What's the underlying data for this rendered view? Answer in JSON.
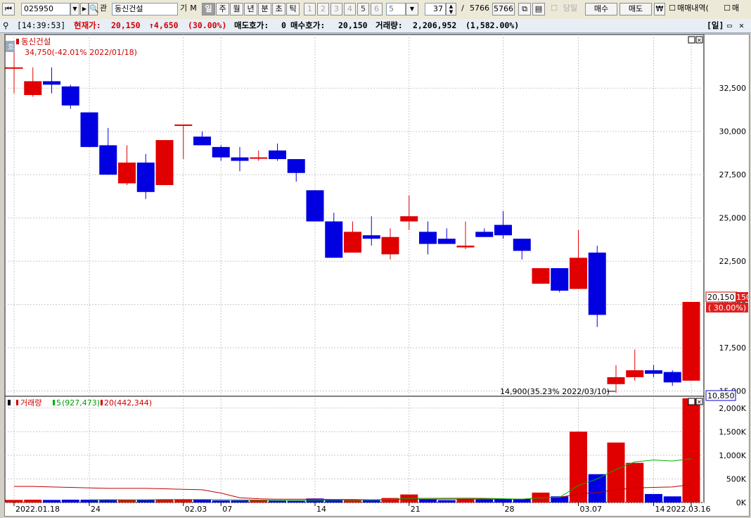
{
  "toolbar": {
    "stock_code": "025950",
    "group_label": "관",
    "stock_name": "동신건설",
    "ki_label": "기",
    "m_label": "M",
    "periods": [
      "일",
      "주",
      "월",
      "년",
      "분",
      "초",
      "틱"
    ],
    "active_period": "일",
    "number_buttons": [
      "1",
      "2",
      "3",
      "4",
      "5",
      "6"
    ],
    "interval_value": "5",
    "count_value": "37",
    "total_sep": "/",
    "total_1": "5766",
    "total_2": "5766",
    "today_label": "당일",
    "buy_label": "매수",
    "sell_label": "매도",
    "won_label": "₩",
    "trade_history_label": "매매내역(",
    "trade_history_label_2": "매"
  },
  "infobar": {
    "time": "[14:39:53]",
    "current_label": "현재가:",
    "current_price": "20,150",
    "change": "↑4,650",
    "change_pct": "(30.00%)",
    "ask_label": "매도호가:",
    "ask_value": "0",
    "bid_label": "매수호가:",
    "bid_value": "20,150",
    "volume_label": "거래량:",
    "volume_value": "2,206,952",
    "volume_pct": "(1,582.00%)",
    "period_tag": "[일]"
  },
  "colors": {
    "up": "#e00000",
    "down": "#0000e0",
    "ma5": "#00b000",
    "ma20": "#c00000",
    "grid": "#c8c8c8"
  },
  "chart_data": [
    {
      "type": "candlestick",
      "title": "동신건설",
      "max_annotation": "34,750(-42.01% 2022/01/18)",
      "min_annotation": "14,900(35.23% 2022/03/10)",
      "last_price_label": "20,150",
      "last_change_label": "( 30.00%)",
      "last_price_tail": "150",
      "bottom_label": "10,850",
      "y_ticks": [
        "32,500",
        "30,000",
        "27,500",
        "25,000",
        "22,500",
        "20,000",
        "17,500",
        "15,000"
      ],
      "y_tick_values": [
        32500,
        30000,
        27500,
        25000,
        22500,
        20000,
        17500,
        15000
      ],
      "ylim": [
        14700,
        35600
      ],
      "grid": true,
      "candles": [
        {
          "date": "2022-01-18",
          "o": 33700,
          "h": 34750,
          "l": 32200,
          "c": 33700
        },
        {
          "date": "2022-01-19",
          "o": 32100,
          "h": 33700,
          "l": 32000,
          "c": 32900
        },
        {
          "date": "2022-01-20",
          "o": 32900,
          "h": 33700,
          "l": 32200,
          "c": 32700
        },
        {
          "date": "2022-01-21",
          "o": 32600,
          "h": 32700,
          "l": 31300,
          "c": 31500
        },
        {
          "date": "2022-01-24",
          "o": 31100,
          "h": 31100,
          "l": 29100,
          "c": 29100
        },
        {
          "date": "2022-01-25",
          "o": 29200,
          "h": 30200,
          "l": 27500,
          "c": 27500
        },
        {
          "date": "2022-01-26",
          "o": 27000,
          "h": 29200,
          "l": 26900,
          "c": 28200
        },
        {
          "date": "2022-01-27",
          "o": 28200,
          "h": 28700,
          "l": 26100,
          "c": 26500
        },
        {
          "date": "2022-01-28",
          "o": 26900,
          "h": 29500,
          "l": 26900,
          "c": 29500
        },
        {
          "date": "2022-02-03",
          "o": 30400,
          "h": 30400,
          "l": 28400,
          "c": 30400
        },
        {
          "date": "2022-02-04",
          "o": 29700,
          "h": 30000,
          "l": 29200,
          "c": 29200
        },
        {
          "date": "2022-02-07",
          "o": 29100,
          "h": 29200,
          "l": 28300,
          "c": 28500
        },
        {
          "date": "2022-02-08",
          "o": 28500,
          "h": 29100,
          "l": 27700,
          "c": 28300
        },
        {
          "date": "2022-02-09",
          "o": 28500,
          "h": 28900,
          "l": 28300,
          "c": 28500
        },
        {
          "date": "2022-02-10",
          "o": 28900,
          "h": 29300,
          "l": 28300,
          "c": 28400
        },
        {
          "date": "2022-02-11",
          "o": 28400,
          "h": 28400,
          "l": 27100,
          "c": 27600
        },
        {
          "date": "2022-02-14",
          "o": 26600,
          "h": 26600,
          "l": 24800,
          "c": 24800
        },
        {
          "date": "2022-02-15",
          "o": 24800,
          "h": 25300,
          "l": 22700,
          "c": 22700
        },
        {
          "date": "2022-02-16",
          "o": 23000,
          "h": 24800,
          "l": 23000,
          "c": 24200
        },
        {
          "date": "2022-02-17",
          "o": 24000,
          "h": 25100,
          "l": 23400,
          "c": 23800
        },
        {
          "date": "2022-02-18",
          "o": 22900,
          "h": 24400,
          "l": 22600,
          "c": 23900
        },
        {
          "date": "2022-02-21",
          "o": 24800,
          "h": 26300,
          "l": 24300,
          "c": 25100
        },
        {
          "date": "2022-02-22",
          "o": 24200,
          "h": 24800,
          "l": 22900,
          "c": 23500
        },
        {
          "date": "2022-02-23",
          "o": 23800,
          "h": 24400,
          "l": 23500,
          "c": 23500
        },
        {
          "date": "2022-02-24",
          "o": 23300,
          "h": 24800,
          "l": 23200,
          "c": 23400
        },
        {
          "date": "2022-02-25",
          "o": 24200,
          "h": 24400,
          "l": 23900,
          "c": 23900
        },
        {
          "date": "2022-02-28",
          "o": 24600,
          "h": 25400,
          "l": 23800,
          "c": 24000
        },
        {
          "date": "2022-03-02",
          "o": 23800,
          "h": 23800,
          "l": 22600,
          "c": 23100
        },
        {
          "date": "2022-03-03",
          "o": 21200,
          "h": 22100,
          "l": 21200,
          "c": 22100
        },
        {
          "date": "2022-03-04",
          "o": 22100,
          "h": 22100,
          "l": 20700,
          "c": 20800
        },
        {
          "date": "2022-03-07",
          "o": 20900,
          "h": 24300,
          "l": 20900,
          "c": 22700
        },
        {
          "date": "2022-03-08",
          "o": 23000,
          "h": 23400,
          "l": 18700,
          "c": 19400
        },
        {
          "date": "2022-03-10",
          "o": 15400,
          "h": 16500,
          "l": 14900,
          "c": 15800
        },
        {
          "date": "2022-03-11",
          "o": 15800,
          "h": 17400,
          "l": 15600,
          "c": 16200
        },
        {
          "date": "2022-03-14",
          "o": 16200,
          "h": 16500,
          "l": 15800,
          "c": 16000
        },
        {
          "date": "2022-03-15",
          "o": 16100,
          "h": 16200,
          "l": 15300,
          "c": 15500
        },
        {
          "date": "2022-03-16",
          "o": 15600,
          "h": 20150,
          "l": 15600,
          "c": 20150
        }
      ],
      "x_labels": [
        {
          "index": 0,
          "text": "2022.01.18"
        },
        {
          "index": 4,
          "text": "24"
        },
        {
          "index": 9,
          "text": "02.03"
        },
        {
          "index": 11,
          "text": "07"
        },
        {
          "index": 16,
          "text": "14"
        },
        {
          "index": 21,
          "text": "21"
        },
        {
          "index": 26,
          "text": "28"
        },
        {
          "index": 30,
          "text": "03.07"
        },
        {
          "index": 34,
          "text": "14"
        },
        {
          "index": 36,
          "text": "2022.03.16"
        }
      ]
    },
    {
      "type": "bar",
      "title": "거래량",
      "legend": [
        {
          "name": "5",
          "value": "(927,473)"
        },
        {
          "name": "20",
          "value": "(442,344)"
        }
      ],
      "y_ticks": [
        "2,000K",
        "1,500K",
        "1,000K",
        "500K",
        "0K"
      ],
      "y_tick_values": [
        2000000,
        1500000,
        1000000,
        500000,
        0
      ],
      "ylim": [
        0,
        2250000
      ],
      "volumes": [
        55000,
        60000,
        55000,
        60000,
        60000,
        60000,
        55000,
        60000,
        70000,
        70000,
        60000,
        45000,
        45000,
        50000,
        40000,
        35000,
        85000,
        65000,
        50000,
        50000,
        95000,
        170000,
        65000,
        50000,
        80000,
        65000,
        75000,
        75000,
        210000,
        130000,
        1500000,
        600000,
        1270000,
        840000,
        180000,
        130000,
        2206952
      ],
      "ma5": [
        null,
        null,
        null,
        null,
        58000,
        60000,
        58000,
        58000,
        61000,
        63000,
        63000,
        61000,
        57000,
        53000,
        47000,
        45000,
        50000,
        55000,
        56000,
        57000,
        63000,
        87000,
        90000,
        91000,
        93000,
        90000,
        80000,
        70000,
        100000,
        110000,
        360000,
        500000,
        700000,
        860000,
        900000,
        880000,
        927473
      ],
      "ma20": [
        340000,
        340000,
        330000,
        320000,
        310000,
        300000,
        300000,
        300000,
        290000,
        280000,
        270000,
        200000,
        100000,
        80000,
        70000,
        70000,
        70000,
        65000,
        65000,
        60000,
        65000,
        70000,
        70000,
        72000,
        75000,
        75000,
        70000,
        70000,
        100000,
        110000,
        180000,
        210000,
        270000,
        310000,
        320000,
        330000,
        380000
      ]
    }
  ]
}
